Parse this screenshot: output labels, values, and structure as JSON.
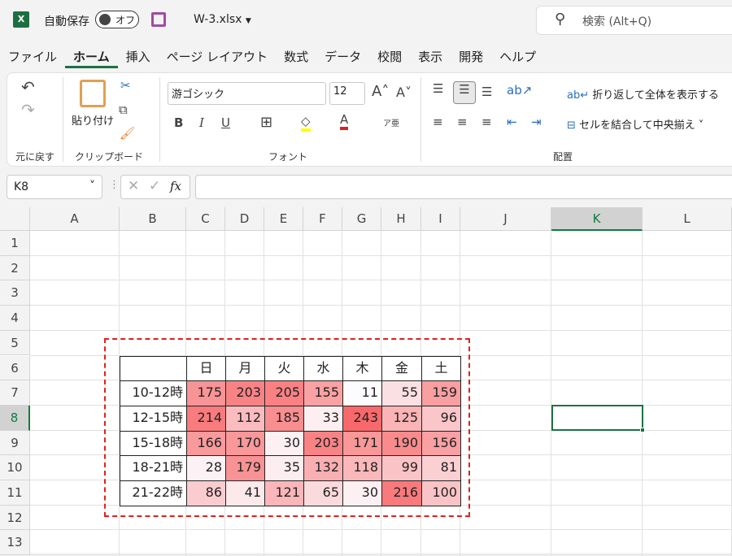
{
  "titlebar": {
    "app_icon": "excel-icon",
    "autosave_label": "自動保存",
    "autosave_state": "オフ",
    "filename": "W-3.xlsx",
    "search_placeholder": "検索 (Alt+Q)"
  },
  "tabs": [
    "ファイル",
    "ホーム",
    "挿入",
    "ページ レイアウト",
    "数式",
    "データ",
    "校閲",
    "表示",
    "開発",
    "ヘルプ"
  ],
  "ribbon": {
    "undo_group": "元に戻す",
    "paste": "貼り付け",
    "clipboard_group": "クリップボード",
    "font_name": "游ゴシック",
    "font_size": "12",
    "font_group": "フォント",
    "bold": "B",
    "italic": "I",
    "underline": "U",
    "wrap_text": "折り返して全体を表示する",
    "merge_center": "セルを結合して中央揃え",
    "alignment_group": "配置"
  },
  "formula_bar": {
    "name_box": "K8",
    "fx": "fx",
    "formula": ""
  },
  "columns": [
    "A",
    "B",
    "C",
    "D",
    "E",
    "F",
    "G",
    "H",
    "I",
    "J",
    "K",
    "L"
  ],
  "rows": [
    "1",
    "2",
    "3",
    "4",
    "5",
    "6",
    "7",
    "8",
    "9",
    "10",
    "11",
    "12",
    "13"
  ],
  "selected": {
    "column": "K",
    "row": "8"
  },
  "table": {
    "days": [
      "日",
      "月",
      "火",
      "水",
      "木",
      "金",
      "土"
    ],
    "slots": [
      "10-12時",
      "12-15時",
      "15-18時",
      "18-21時",
      "21-22時"
    ],
    "values": [
      [
        175,
        203,
        205,
        155,
        11,
        55,
        159
      ],
      [
        214,
        112,
        185,
        33,
        243,
        125,
        96
      ],
      [
        166,
        170,
        30,
        203,
        171,
        190,
        156
      ],
      [
        28,
        179,
        35,
        132,
        118,
        99,
        81
      ],
      [
        86,
        41,
        121,
        65,
        30,
        216,
        100
      ]
    ],
    "scale_min_color": "#fcfcff",
    "scale_max_color": "#f8696b"
  }
}
